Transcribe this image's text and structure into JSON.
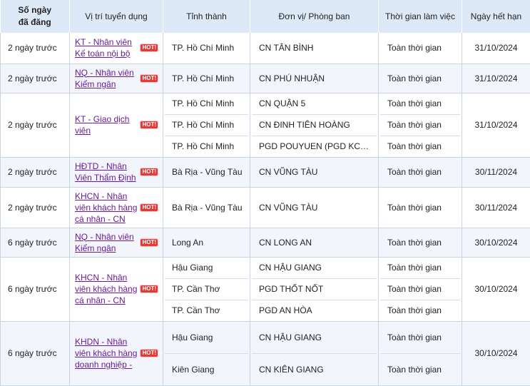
{
  "headers": {
    "days": "Số ngày\nđã đăng",
    "position": "Vị trí tuyển dụng",
    "city": "Tỉnh thành",
    "unit": "Đơn vị/ Phòng ban",
    "time": "Thời gian làm việc",
    "deadline": "Ngày hết hạn"
  },
  "hot_label": "HOT!",
  "rows": [
    {
      "days": "2 ngày trước",
      "position": "KT - Nhân viên Kế toán nội bộ",
      "deadline": "31/10/2024",
      "locations": [
        {
          "city": "TP. Hồ Chí Minh",
          "unit": "CN TÂN BÌNH",
          "time": "Toàn thời gian"
        }
      ]
    },
    {
      "days": "2 ngày trước",
      "position": "NQ - Nhân viên Kiểm ngân",
      "deadline": "31/10/2024",
      "locations": [
        {
          "city": "TP. Hồ Chí Minh",
          "unit": "CN PHÚ NHUẬN",
          "time": "Toàn thời gian"
        }
      ]
    },
    {
      "days": "2 ngày trước",
      "position": "KT - Giao dịch viên",
      "deadline": "31/10/2024",
      "locations": [
        {
          "city": "TP. Hồ Chí Minh",
          "unit": "CN QUẬN 5",
          "time": "Toàn thời gian"
        },
        {
          "city": "TP. Hồ Chí Minh",
          "unit": "CN ĐINH TIÊN HOÀNG",
          "time": "Toàn thời gian"
        },
        {
          "city": "TP. Hồ Chí Minh",
          "unit": "PGD POUYUEN (PGD KC…",
          "time": "Toàn thời gian"
        }
      ]
    },
    {
      "days": "2 ngày trước",
      "position": "HĐTD - Nhân Viên Thẩm Định",
      "deadline": "30/11/2024",
      "locations": [
        {
          "city": "Bà Rịa - Vũng Tàu",
          "unit": "CN VŨNG TÀU",
          "time": "Toàn thời gian"
        }
      ]
    },
    {
      "days": "2 ngày trước",
      "position": "KHCN - Nhân viên khách hàng cá nhân - CN",
      "deadline": "30/11/2024",
      "locations": [
        {
          "city": "Bà Rịa - Vũng Tàu",
          "unit": "CN VŨNG TÀU",
          "time": "Toàn thời gian"
        }
      ]
    },
    {
      "days": "6 ngày trước",
      "position": "NQ - Nhân viên Kiểm ngân",
      "deadline": "30/10/2024",
      "locations": [
        {
          "city": "Long An",
          "unit": "CN LONG AN",
          "time": "Toàn thời gian"
        }
      ]
    },
    {
      "days": "6 ngày trước",
      "position": "KHCN - Nhân viên khách hàng cá nhân - CN",
      "deadline": "30/10/2024",
      "locations": [
        {
          "city": "Hậu Giang",
          "unit": "CN HẬU GIANG",
          "time": "Toàn thời gian"
        },
        {
          "city": "TP. Cần Thơ",
          "unit": "PGD THỐT NỐT",
          "time": "Toàn thời gian"
        },
        {
          "city": "TP. Cần Thơ",
          "unit": "PGD AN HÒA",
          "time": "Toàn thời gian"
        }
      ]
    },
    {
      "days": "6 ngày trước",
      "position": "KHDN - Nhân viên khách hàng doanh nghiệp -",
      "deadline": "30/10/2024",
      "locations": [
        {
          "city": "Hậu Giang",
          "unit": "CN HẬU GIANG",
          "time": "Toàn thời gian"
        },
        {
          "city": "Kiên Giang",
          "unit": "CN KIÊN GIANG",
          "time": "Toàn thời gian"
        }
      ]
    }
  ]
}
